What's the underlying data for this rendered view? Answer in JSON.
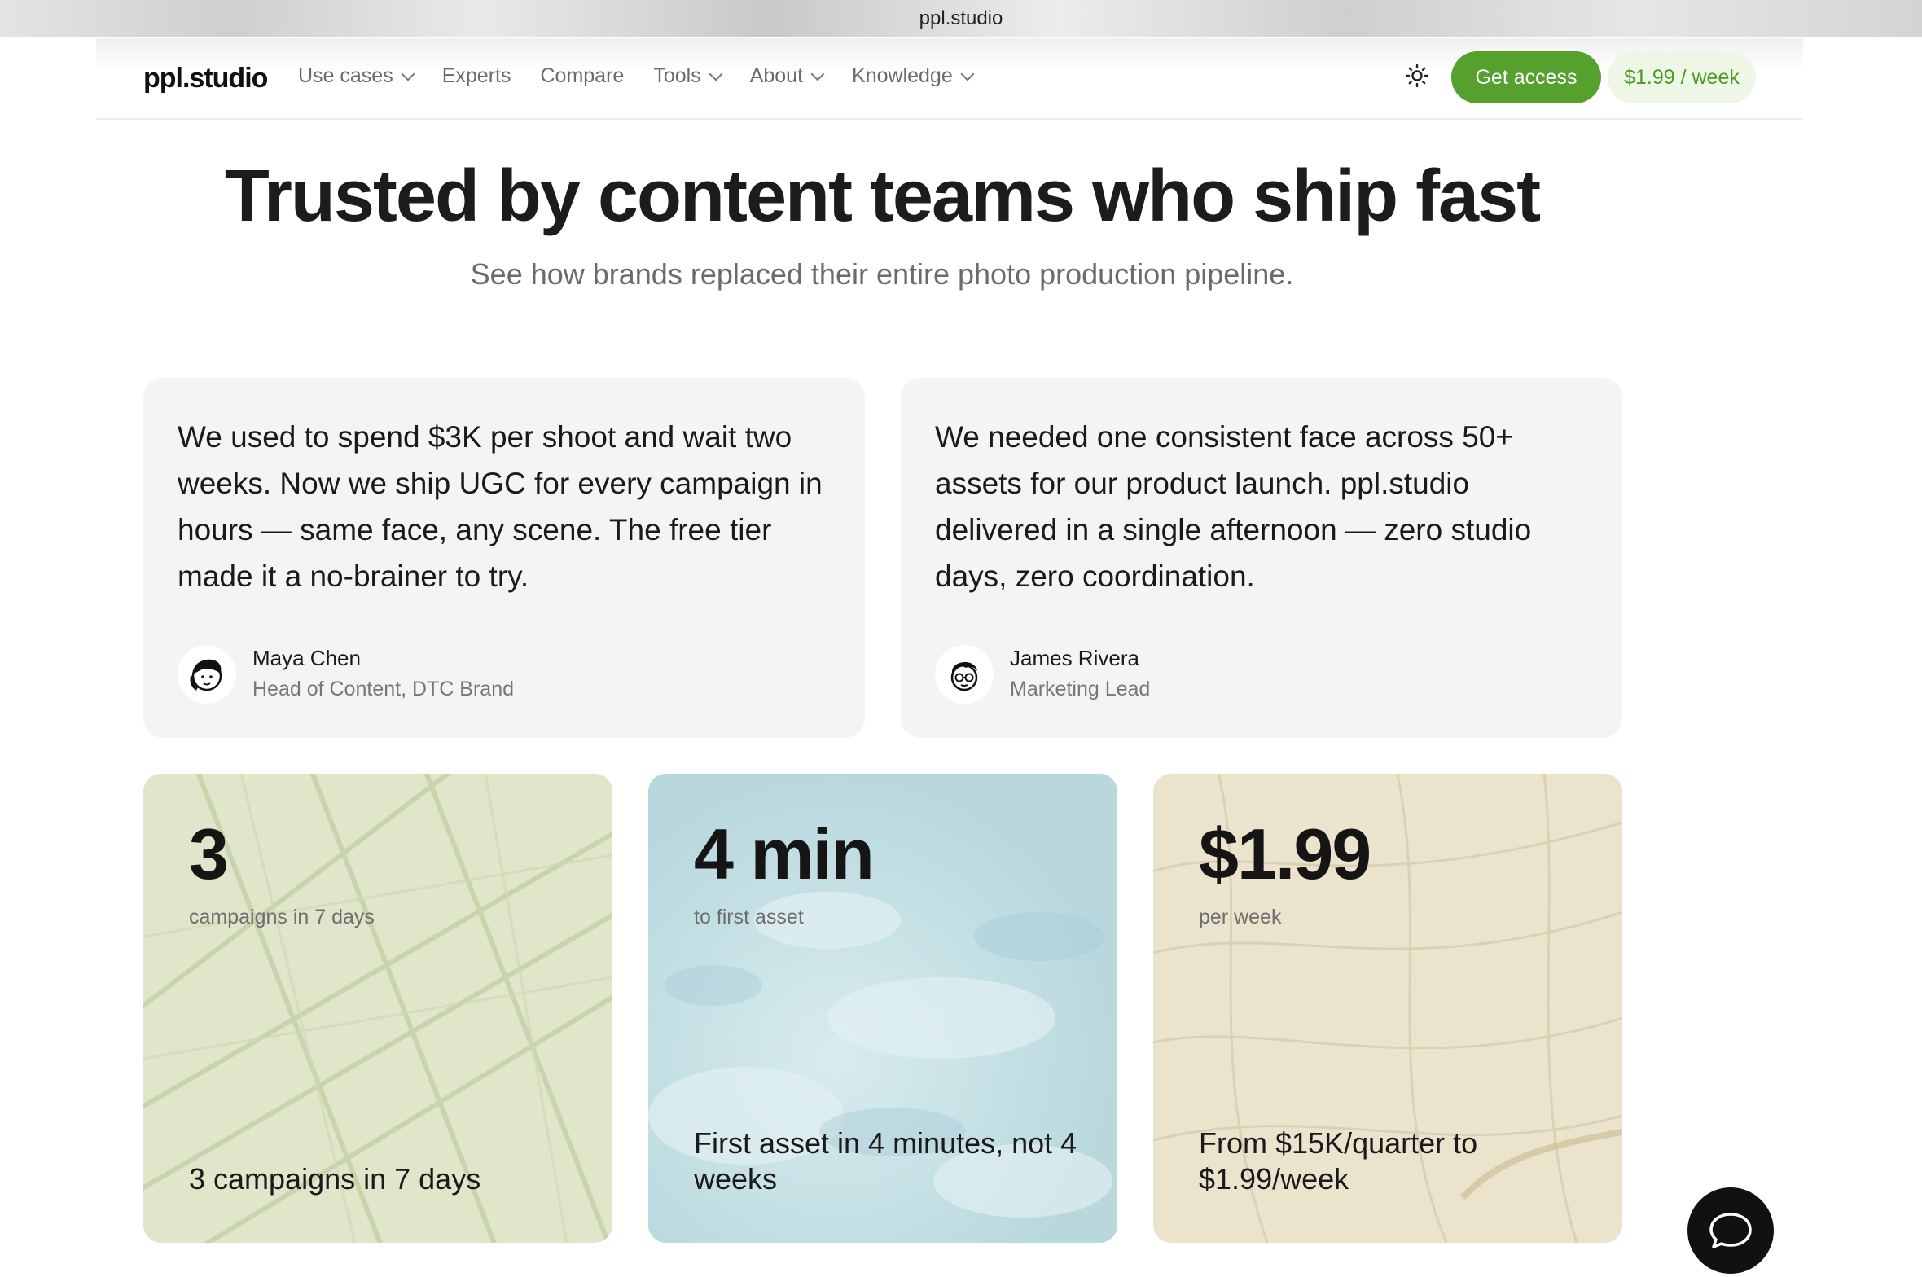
{
  "browser": {
    "url": "ppl.studio"
  },
  "header": {
    "logo": "ppl.studio",
    "nav": [
      {
        "label": "Use cases",
        "dropdown": true
      },
      {
        "label": "Experts",
        "dropdown": false
      },
      {
        "label": "Compare",
        "dropdown": false
      },
      {
        "label": "Tools",
        "dropdown": true
      },
      {
        "label": "About",
        "dropdown": true
      },
      {
        "label": "Knowledge",
        "dropdown": true
      }
    ],
    "theme_icon": "sun-icon",
    "cta_label": "Get access",
    "price_label": "$1.99 / week"
  },
  "hero": {
    "title": "Trusted by content teams who ship fast",
    "subtitle": "See how brands replaced their entire photo production pipeline."
  },
  "testimonials": [
    {
      "quote": "We used to spend $3K per shoot and wait two weeks. Now we ship UGC for every campaign in hours — same face, any scene. The free tier made it a no-brainer to try.",
      "name": "Maya Chen",
      "role": "Head of Content, DTC Brand"
    },
    {
      "quote": "We needed one consistent face across 50+ assets for our product launch. ppl.studio delivered in a single afternoon — zero studio days, zero coordination.",
      "name": "James Rivera",
      "role": "Marketing Lead"
    }
  ],
  "stats": [
    {
      "value": "3",
      "label": "campaigns in 7 days",
      "caption": "3 campaigns in 7 days"
    },
    {
      "value": "4 min",
      "label": "to first asset",
      "caption": "First asset in 4 minutes, not 4 weeks"
    },
    {
      "value": "$1.99",
      "label": "per week",
      "caption": "From $15K/quarter to $1.99/week"
    }
  ],
  "colors": {
    "accent": "#56a02e",
    "accent_soft": "#eef6e6",
    "card_bg": "#f4f4f4",
    "stat_green": "#dfe6c9",
    "stat_blue": "#c6e1e6",
    "stat_sand": "#ece3cc"
  },
  "chat_icon": "chat-bubble-icon"
}
